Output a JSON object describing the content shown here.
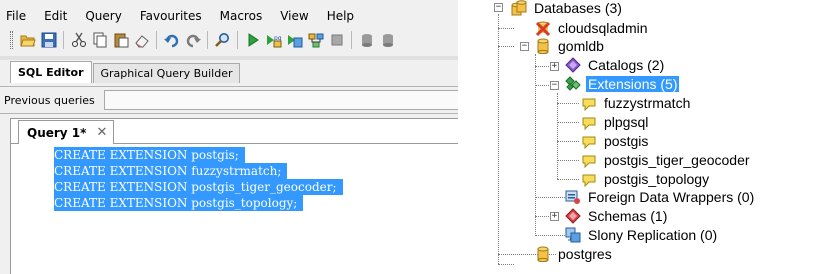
{
  "menu": [
    "File",
    "Edit",
    "Query",
    "Favourites",
    "Macros",
    "View",
    "Help"
  ],
  "toolbar_icons": [
    "open-icon",
    "save-icon",
    "cut-icon",
    "copy-icon",
    "paste-icon",
    "eraser-icon",
    "undo-icon",
    "redo-icon",
    "find-icon",
    "execute-icon",
    "execute-pgscript-icon",
    "execute-to-file-icon",
    "explain-icon",
    "stop-icon",
    "commit-icon"
  ],
  "tabs": {
    "sql_editor": "SQL Editor",
    "graphical_query_builder": "Graphical Query Builder"
  },
  "previous_queries_label": "Previous queries",
  "editor": {
    "tab_title": "Query 1*",
    "close_glyph": "✕",
    "lines": [
      "CREATE EXTENSION postgis;",
      "CREATE EXTENSION fuzzystrmatch;",
      "CREATE EXTENSION postgis_tiger_geocoder;",
      "CREATE EXTENSION postgis_topology;"
    ]
  },
  "tree": {
    "databases": "Databases (3)",
    "cloudsqladmin": "cloudsqladmin",
    "gomldb": "gomldb",
    "catalogs": "Catalogs (2)",
    "extensions": "Extensions (5)",
    "extension_items": [
      "fuzzystrmatch",
      "plpgsql",
      "postgis",
      "postgis_tiger_geocoder",
      "postgis_topology"
    ],
    "foreign_data_wrappers": "Foreign Data Wrappers (0)",
    "schemas": "Schemas (1)",
    "slony_replication": "Slony Replication (0)",
    "postgres": "postgres"
  },
  "colors": {
    "selection": "#3399ff",
    "pane_background": "#f0f0f0",
    "database_icon": "#f3c24a",
    "extension_icon": "#3aa34a",
    "catalog_icon": "#8a58c8",
    "schema_icon": "#d8434a",
    "error_badge": "#d83a2a"
  }
}
